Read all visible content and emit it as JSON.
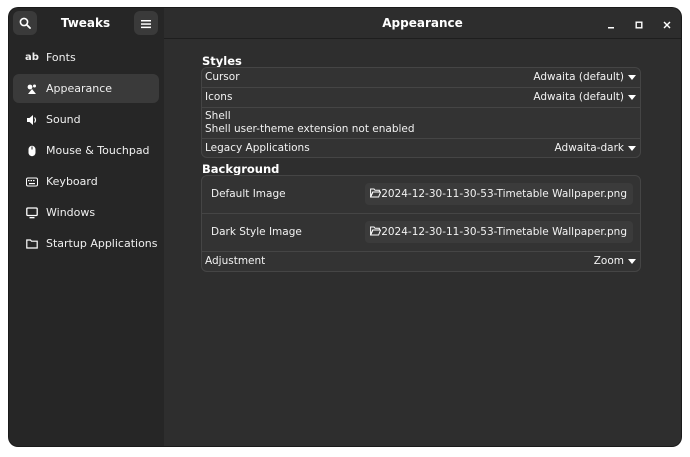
{
  "sidebar": {
    "title": "Tweaks",
    "items": [
      {
        "label": "Fonts",
        "icon": "fonts-icon",
        "glyph": "ab"
      },
      {
        "label": "Appearance",
        "icon": "appearance-icon"
      },
      {
        "label": "Sound",
        "icon": "speaker-icon"
      },
      {
        "label": "Mouse & Touchpad",
        "icon": "mouse-icon"
      },
      {
        "label": "Keyboard",
        "icon": "keyboard-icon"
      },
      {
        "label": "Windows",
        "icon": "monitor-icon"
      },
      {
        "label": "Startup Applications",
        "icon": "folder-icon"
      }
    ],
    "active": "Appearance"
  },
  "header": {
    "title": "Appearance"
  },
  "styles": {
    "title": "Styles",
    "cursor": {
      "label": "Cursor",
      "value": "Adwaita (default)"
    },
    "icons": {
      "label": "Icons",
      "value": "Adwaita (default)"
    },
    "shell": {
      "label": "Shell",
      "note": "Shell user-theme extension not enabled"
    },
    "legacy": {
      "label": "Legacy Applications",
      "value": "Adwaita-dark"
    }
  },
  "background": {
    "title": "Background",
    "default_image": {
      "label": "Default Image",
      "file": "2024-12-30-11-30-53-Timetable Wallpaper.png"
    },
    "dark_image": {
      "label": "Dark Style Image",
      "file": "2024-12-30-11-30-53-Timetable Wallpaper.png"
    },
    "adjustment": {
      "label": "Adjustment",
      "value": "Zoom"
    }
  },
  "colors": {
    "window_bg": "#2d2d2d",
    "sidebar_bg": "#262626",
    "active_item": "#3a3a3a",
    "text": "#ffffff"
  }
}
